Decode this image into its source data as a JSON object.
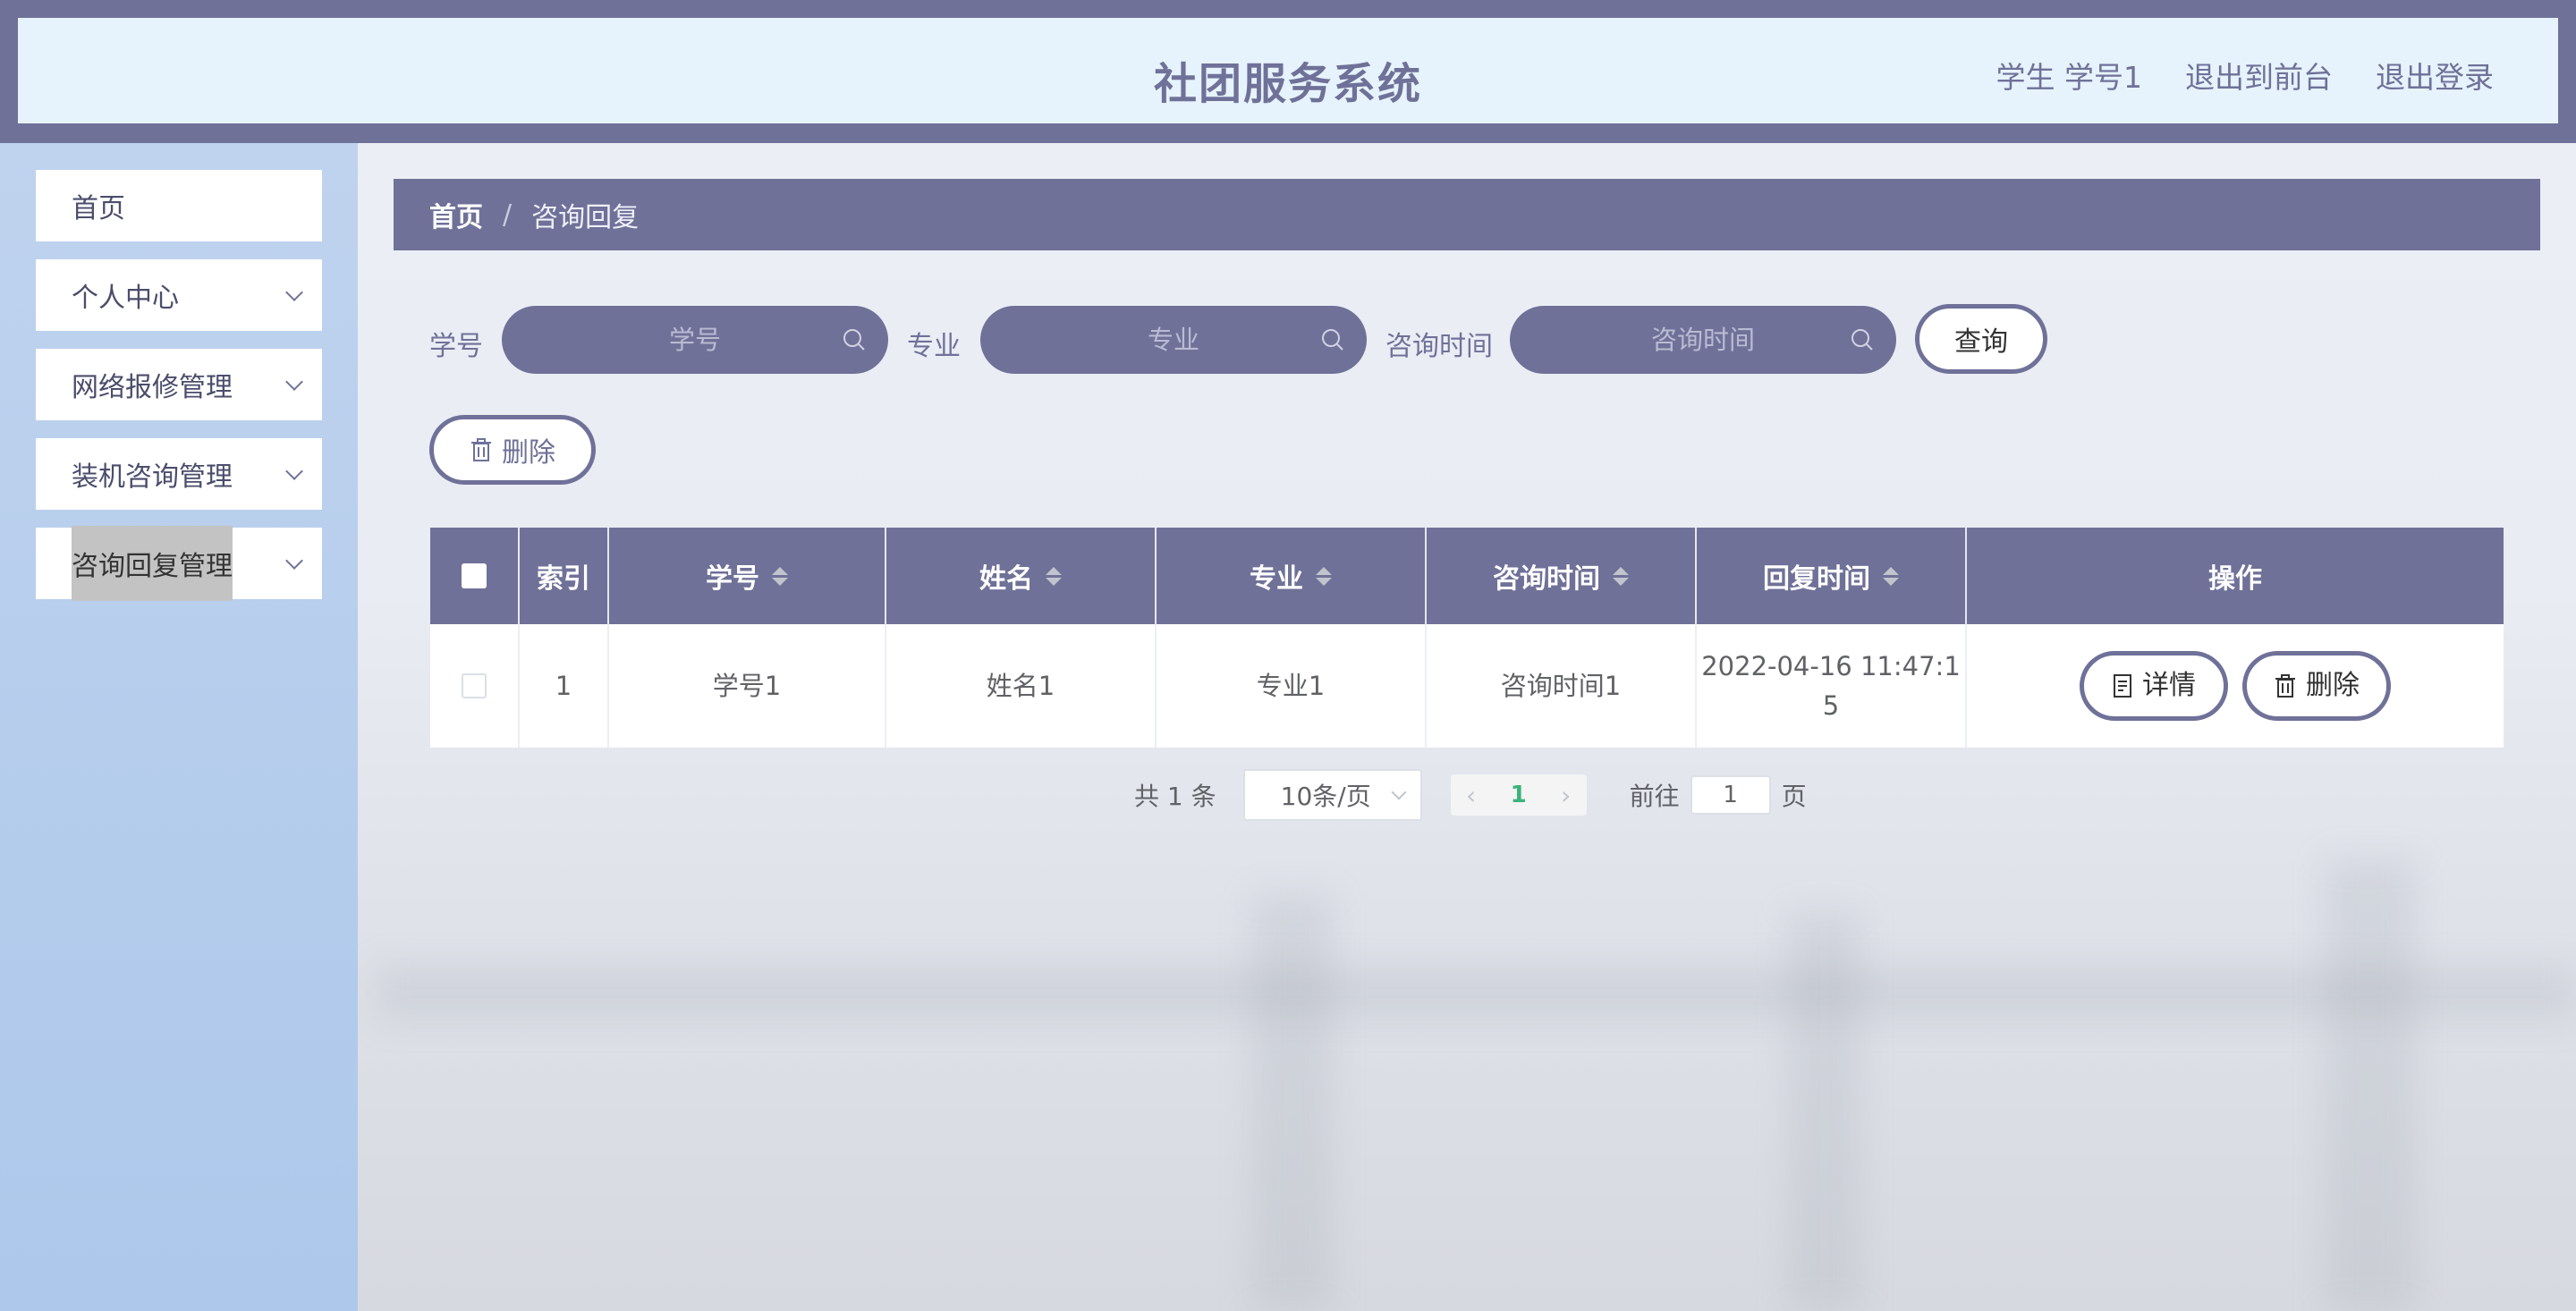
{
  "header": {
    "title": "社团服务系统",
    "user_label": "学生 学号1",
    "to_front_label": "退出到前台",
    "logout_label": "退出登录"
  },
  "sidebar": {
    "items": [
      {
        "label": "首页"
      },
      {
        "label": "个人中心"
      },
      {
        "label": "网络报修管理"
      },
      {
        "label": "装机咨询管理"
      },
      {
        "label": "咨询回复管理"
      }
    ]
  },
  "breadcrumb": {
    "home": "首页",
    "separator": "/",
    "current": "咨询回复"
  },
  "search": {
    "student_id_label": "学号",
    "student_id_placeholder": "学号",
    "major_label": "专业",
    "major_placeholder": "专业",
    "time_label": "咨询时间",
    "time_placeholder": "咨询时间",
    "query_button": "查询",
    "delete_button": "删除"
  },
  "table": {
    "columns": [
      "索引",
      "学号",
      "姓名",
      "专业",
      "咨询时间",
      "回复时间",
      "操作"
    ],
    "rows": [
      {
        "index": "1",
        "student_id": "学号1",
        "name": "姓名1",
        "major": "专业1",
        "consult_time": "咨询时间1",
        "reply_time": "2022-04-16 11:47:1\n5",
        "detail_button": "详情",
        "delete_button": "删除"
      }
    ]
  },
  "pagination": {
    "total": "共 1 条",
    "page_size": "10条/页",
    "current_page": "1",
    "goto_label": "前往",
    "goto_value": "1",
    "page_suffix": "页"
  },
  "colors": {
    "accent": "#6f7198",
    "header_bg": "#e6f3fc",
    "sidebar_bg": "#b4cdec",
    "active_page": "#3bb37a"
  }
}
